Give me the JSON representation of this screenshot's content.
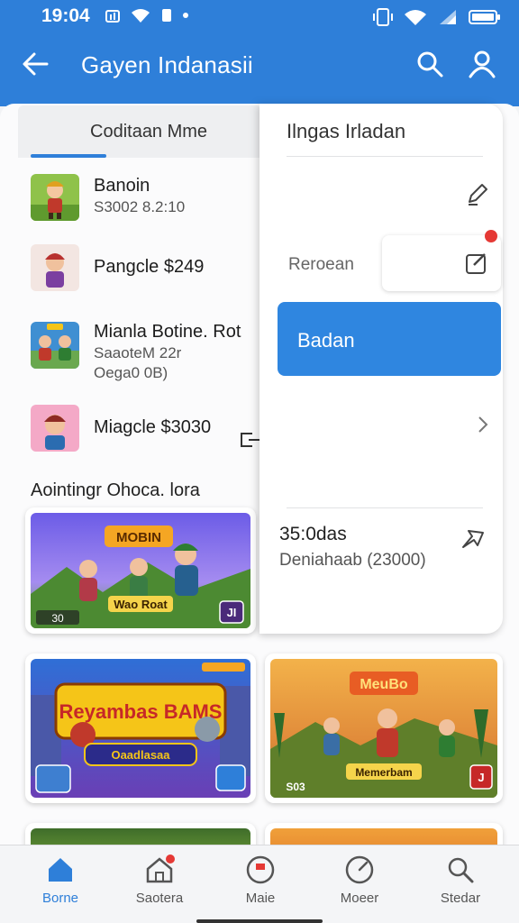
{
  "status_bar": {
    "time": "19:04"
  },
  "app_bar": {
    "title": "Gayen Indanasii",
    "back_icon": "arrow-left-icon",
    "actions": [
      "search-icon",
      "person-icon"
    ]
  },
  "left_tab": {
    "label": "Coditaan Mme"
  },
  "list_items": [
    {
      "name": "Banoin",
      "sub1": "S3002 8.2:10",
      "sub2": ""
    },
    {
      "name": "Pangcle $249",
      "sub1": "",
      "sub2": ""
    },
    {
      "name": "Mianla Botine. Rot",
      "sub1": "SaaoteM 22r",
      "sub2": "Oega0 0B)"
    },
    {
      "name": "Miagcle $3030",
      "sub1": "",
      "sub2": ""
    }
  ],
  "section": {
    "title": "Aointingr Ohoca. lora"
  },
  "cards": [
    {
      "banner": "MOBIN",
      "label": "Wao Roat",
      "badge": "30",
      "corner": "JI"
    },
    {
      "banner": "Reyambas BAMS",
      "label": "Oaadlasaa",
      "badge": "",
      "corner": ""
    },
    {
      "banner": "MeuBo",
      "label": "Memerbam",
      "badge": "S03",
      "corner": "J"
    }
  ],
  "panel": {
    "title": "Ilngas Irladan",
    "field_label": "Reroean",
    "button_label": "Badan",
    "time": "35:0das",
    "subtitle": "Deniahaab (23000)"
  },
  "bottom_nav": [
    {
      "label": "Borne",
      "icon": "home-icon",
      "active": true
    },
    {
      "label": "Saotera",
      "icon": "store-icon",
      "active": false
    },
    {
      "label": "Maie",
      "icon": "record-icon",
      "active": false
    },
    {
      "label": "Moeer",
      "icon": "gauge-icon",
      "active": false
    },
    {
      "label": "Stedar",
      "icon": "search-icon",
      "active": false
    }
  ],
  "colors": {
    "primary": "#2e7fd9",
    "alert": "#e53935",
    "background": "#f2f3f5"
  }
}
